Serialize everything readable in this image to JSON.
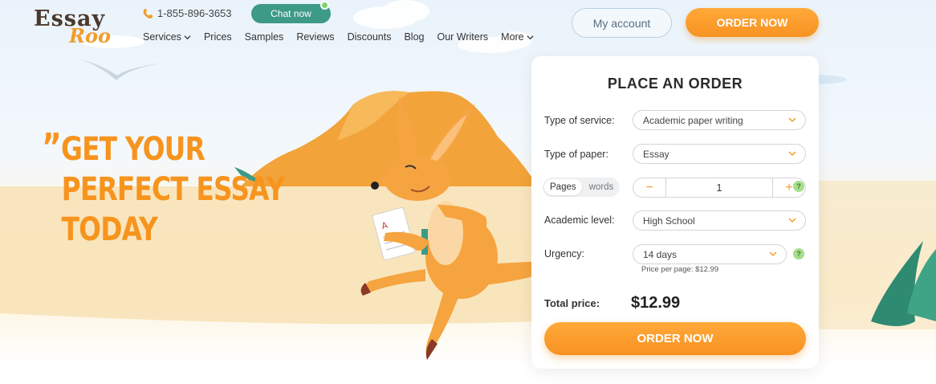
{
  "header": {
    "logo_alt": "EssayRoo",
    "logo_text_1": "Essay",
    "logo_text_2": "Roo",
    "phone": "1-855-896-3653",
    "chat_label": "Chat now",
    "my_account_label": "My account",
    "order_now_label": "ORDER NOW"
  },
  "nav": {
    "items": [
      {
        "label": "Services",
        "dropdown": true
      },
      {
        "label": "Prices",
        "dropdown": false
      },
      {
        "label": "Samples",
        "dropdown": false
      },
      {
        "label": "Reviews",
        "dropdown": false
      },
      {
        "label": "Discounts",
        "dropdown": false
      },
      {
        "label": "Blog",
        "dropdown": false
      },
      {
        "label": "Our Writers",
        "dropdown": false
      },
      {
        "label": "More",
        "dropdown": true
      }
    ]
  },
  "hero": {
    "quote_mark": "”",
    "line1": "GET YOUR",
    "line2": "PERFECT ESSAY",
    "line3": "TODAY"
  },
  "order_form": {
    "title": "PLACE AN ORDER",
    "service_label": "Type of service:",
    "service_value": "Academic paper writing",
    "paper_label": "Type of paper:",
    "paper_value": "Essay",
    "unit_toggle": {
      "selected": "Pages",
      "other": "words"
    },
    "pages_value": "1",
    "minus": "−",
    "plus": "+",
    "level_label": "Academic level:",
    "level_value": "High School",
    "urgency_label": "Urgency:",
    "urgency_value": "14 days",
    "price_per_page": "Price per page: $12.99",
    "total_label": "Total price:",
    "total_value": "$12.99",
    "help": "?",
    "order_button": "ORDER NOW"
  },
  "colors": {
    "accent": "#f7941e",
    "chat_green": "#3d9a86",
    "help_green": "#a9dc8e"
  },
  "icons": [
    "phone-icon",
    "chevron-down-icon",
    "help-icon",
    "minus-icon",
    "plus-icon"
  ]
}
